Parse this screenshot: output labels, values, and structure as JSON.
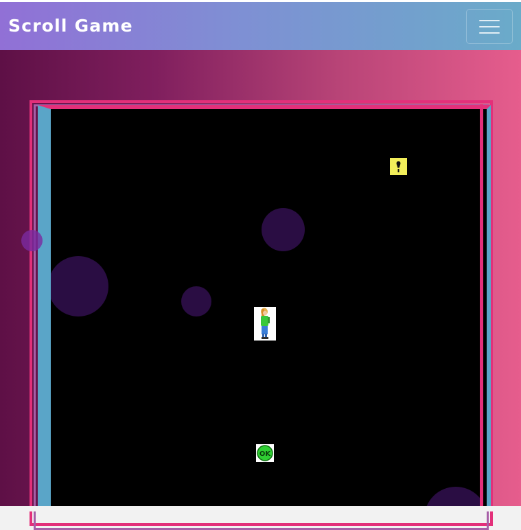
{
  "navbar": {
    "brand": "Scroll Game",
    "toggle_icon": "hamburger-menu-icon"
  },
  "game": {
    "sprites": {
      "player": "player-character-icon",
      "exit": "exclamation-tile-icon",
      "ok": "ok-button-icon"
    },
    "ok_label": "OK",
    "colors": {
      "playfield": "#000000",
      "frame_pink": "#e3307a",
      "frame_blue": "#5aa5c8",
      "bubble": "#2a0d43"
    }
  }
}
